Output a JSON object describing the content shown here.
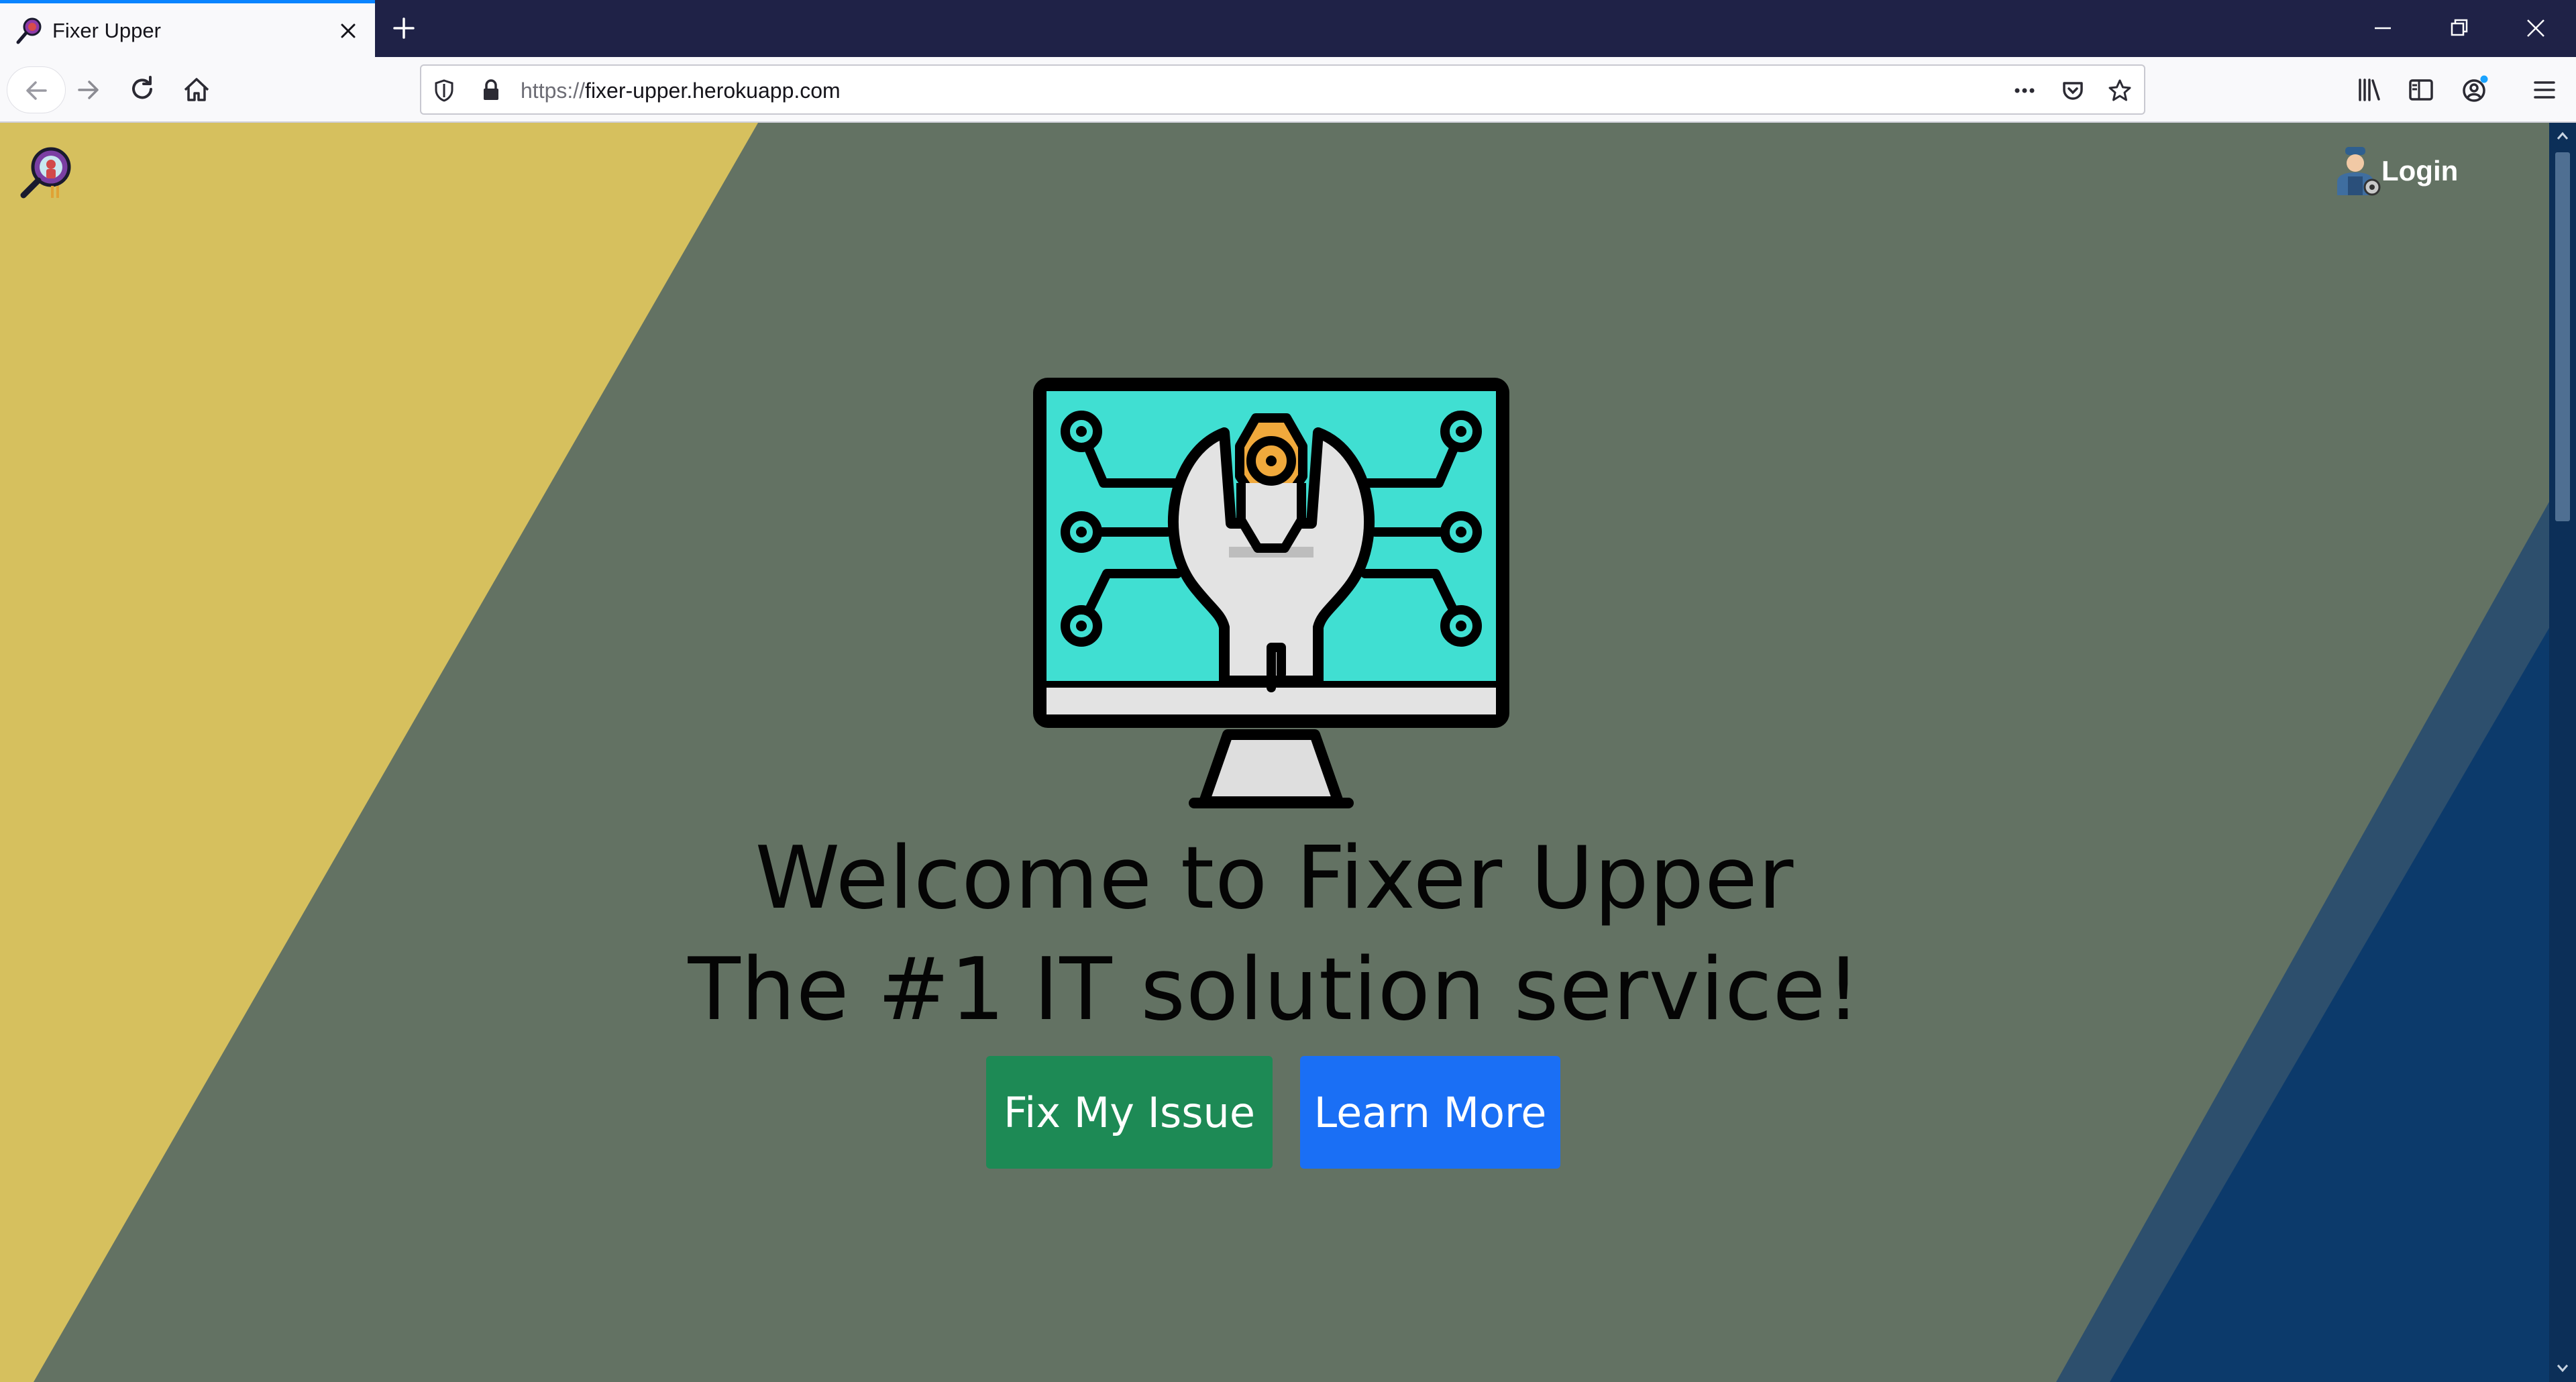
{
  "browser": {
    "tab_title": "Fixer Upper",
    "url_scheme": "https://",
    "url_host": "fixer-upper.herokuapp.com"
  },
  "site": {
    "login_label": "Login"
  },
  "hero": {
    "title_line1": "Welcome to Fixer Upper",
    "title_line2": "The #1 IT solution service!",
    "primary_button": "Fix My Issue",
    "secondary_button": "Learn More"
  },
  "colors": {
    "page_background": "#637263",
    "left_stripe": "#d6c05e",
    "right_stripe_dark": "#0c3a6b",
    "right_stripe_light": "#2d4f6d",
    "primary_button": "#1d8a55",
    "secondary_button": "#1a6ff5",
    "monitor_screen": "#40dfd2",
    "nut": "#f0a93c"
  },
  "icons": {
    "favicon": "magnifier-person-icon",
    "hero": "monitor-wrench-circuit-icon",
    "login": "technician-avatar-icon"
  }
}
